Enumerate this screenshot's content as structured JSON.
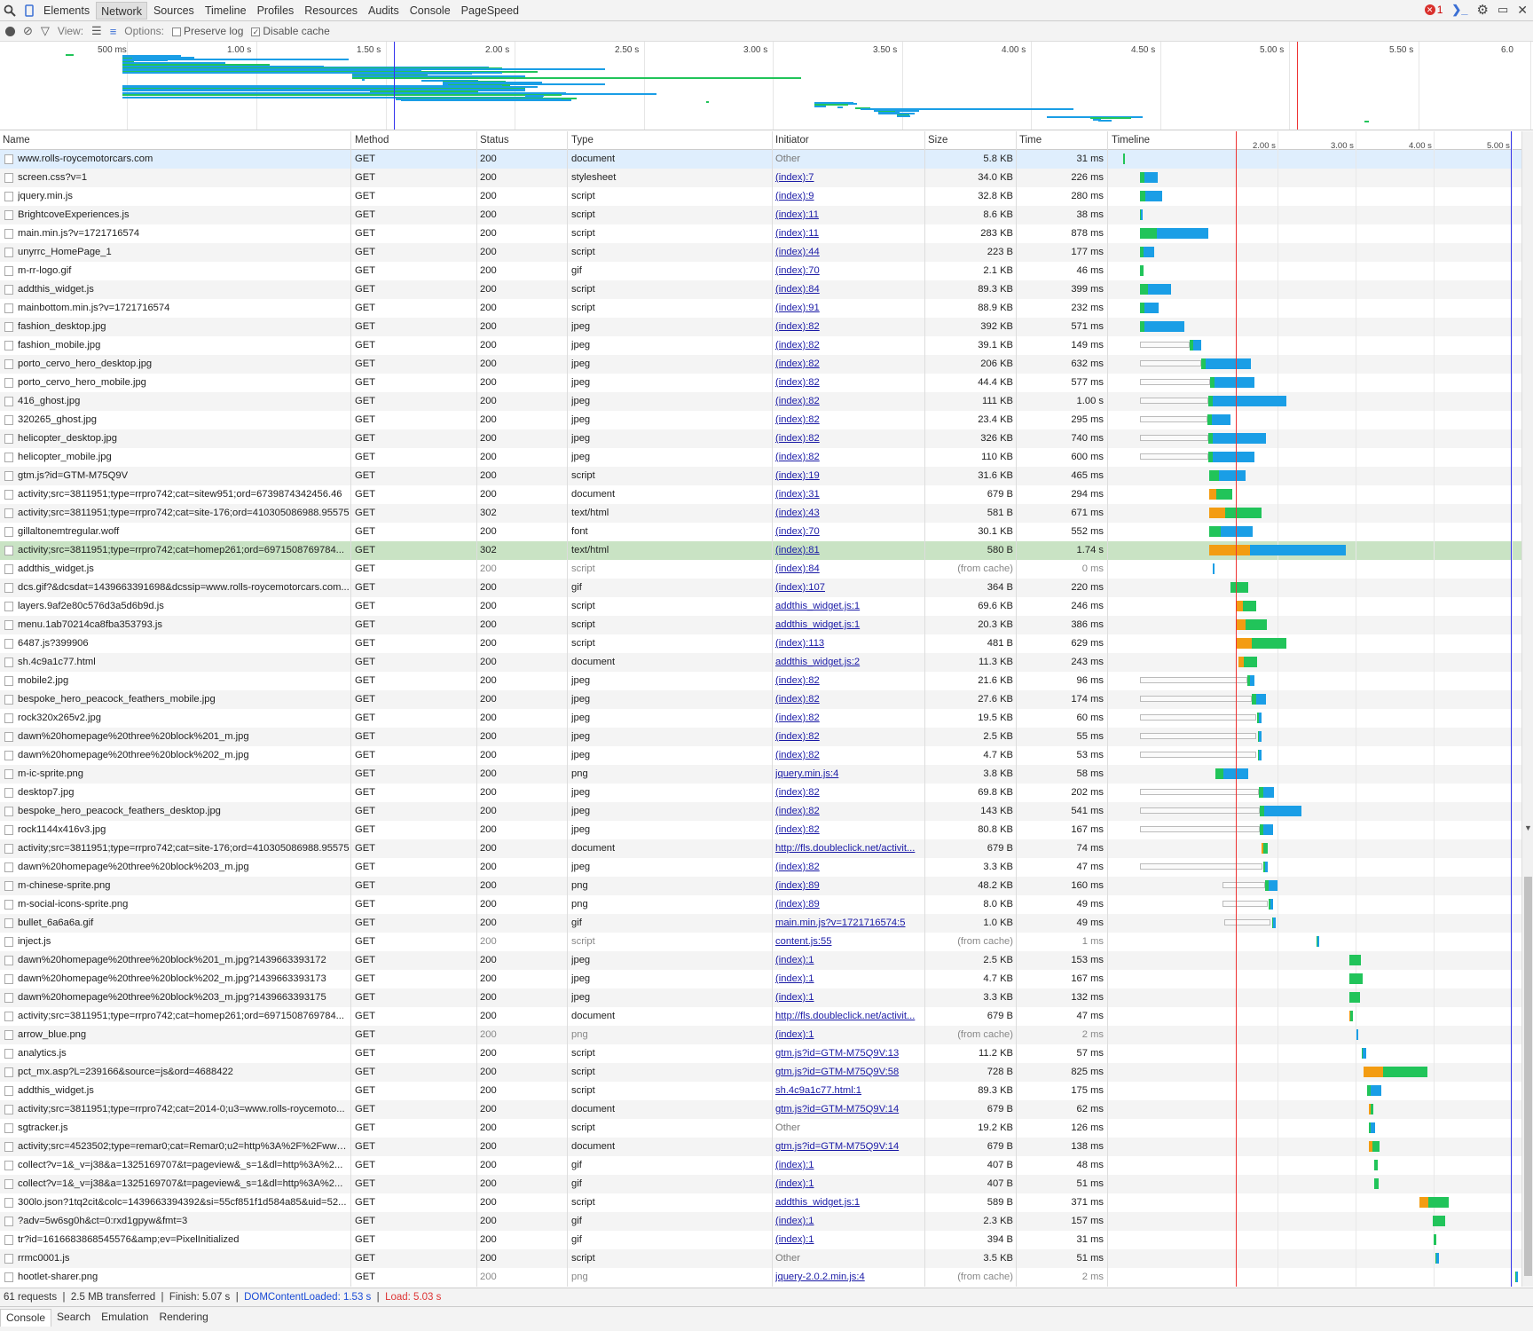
{
  "tabs": [
    "Elements",
    "Network",
    "Sources",
    "Timeline",
    "Profiles",
    "Resources",
    "Audits",
    "Console",
    "PageSpeed"
  ],
  "active_tab": "Network",
  "error_count": "1",
  "toolbar": {
    "view_label": "View:",
    "options_label": "Options:",
    "preserve_log": "Preserve log",
    "disable_cache": "Disable cache",
    "preserve_log_checked": false,
    "disable_cache_checked": true
  },
  "overview_labels": [
    "500 ms",
    "1.00 s",
    "1.50 s",
    "2.00 s",
    "2.50 s",
    "3.00 s",
    "3.50 s",
    "4.00 s",
    "4.50 s",
    "5.00 s",
    "5.50 s",
    "6.0"
  ],
  "columns": {
    "name": "Name",
    "method": "Method",
    "status": "Status",
    "type": "Type",
    "initiator": "Initiator",
    "size": "Size",
    "time": "Time",
    "timeline": "Timeline"
  },
  "timeline_labels": [
    "2.00 s",
    "3.00 s",
    "4.00 s",
    "5.00 s"
  ],
  "colors": {
    "blue": "#1a9ee6",
    "green": "#21c45a",
    "orange": "#f39c12",
    "gray": "#a0a0a0",
    "dom_line": "#3333ee",
    "load_line": "#e33333"
  },
  "requests": [
    {
      "name": "www.rolls-roycemotorcars.com",
      "method": "GET",
      "status": "200",
      "type": "document",
      "initiator": "Other",
      "size": "5.8 KB",
      "time": "31 ms",
      "start": 0.02,
      "dur": 0.031
    },
    {
      "name": "screen.css?v=1",
      "method": "GET",
      "status": "200",
      "type": "stylesheet",
      "initiator": "(index):7",
      "size": "34.0 KB",
      "time": "226 ms",
      "start": 0.24,
      "dur": 0.226
    },
    {
      "name": "jquery.min.js",
      "method": "GET",
      "status": "200",
      "type": "script",
      "initiator": "(index):9",
      "size": "32.8 KB",
      "time": "280 ms",
      "start": 0.24,
      "dur": 0.28
    },
    {
      "name": "BrightcoveExperiences.js",
      "method": "GET",
      "status": "200",
      "type": "script",
      "initiator": "(index):11",
      "size": "8.6 KB",
      "time": "38 ms",
      "start": 0.24,
      "dur": 0.038
    },
    {
      "name": "main.min.js?v=1721716574",
      "method": "GET",
      "status": "200",
      "type": "script",
      "initiator": "(index):11",
      "size": "283 KB",
      "time": "878 ms",
      "start": 0.24,
      "dur": 0.878
    },
    {
      "name": "unyrrc_HomePage_1",
      "method": "GET",
      "status": "200",
      "type": "script",
      "initiator": "(index):44",
      "size": "223 B",
      "time": "177 ms",
      "start": 0.24,
      "dur": 0.177
    },
    {
      "name": "m-rr-logo.gif",
      "method": "GET",
      "status": "200",
      "type": "gif",
      "initiator": "(index):70",
      "size": "2.1 KB",
      "time": "46 ms",
      "start": 0.24,
      "dur": 0.046
    },
    {
      "name": "addthis_widget.js",
      "method": "GET",
      "status": "200",
      "type": "script",
      "initiator": "(index):84",
      "size": "89.3 KB",
      "time": "399 ms",
      "start": 0.24,
      "dur": 0.399
    },
    {
      "name": "mainbottom.min.js?v=1721716574",
      "method": "GET",
      "status": "200",
      "type": "script",
      "initiator": "(index):91",
      "size": "88.9 KB",
      "time": "232 ms",
      "start": 0.24,
      "dur": 0.232
    },
    {
      "name": "fashion_desktop.jpg",
      "method": "GET",
      "status": "200",
      "type": "jpeg",
      "initiator": "(index):82",
      "size": "392 KB",
      "time": "571 ms",
      "start": 0.24,
      "dur": 0.571
    },
    {
      "name": "fashion_mobile.jpg",
      "method": "GET",
      "status": "200",
      "type": "jpeg",
      "initiator": "(index):82",
      "size": "39.1 KB",
      "time": "149 ms",
      "start": 0.24,
      "dur": 0.78
    },
    {
      "name": "porto_cervo_hero_desktop.jpg",
      "method": "GET",
      "status": "200",
      "type": "jpeg",
      "initiator": "(index):82",
      "size": "206 KB",
      "time": "632 ms",
      "start": 0.24,
      "dur": 1.42
    },
    {
      "name": "porto_cervo_hero_mobile.jpg",
      "method": "GET",
      "status": "200",
      "type": "jpeg",
      "initiator": "(index):82",
      "size": "44.4 KB",
      "time": "577 ms",
      "start": 0.24,
      "dur": 1.47
    },
    {
      "name": "416_ghost.jpg",
      "method": "GET",
      "status": "200",
      "type": "jpeg",
      "initiator": "(index):82",
      "size": "111 KB",
      "time": "1.00 s",
      "start": 0.24,
      "dur": 1.87
    },
    {
      "name": "320265_ghost.jpg",
      "method": "GET",
      "status": "200",
      "type": "jpeg",
      "initiator": "(index):82",
      "size": "23.4 KB",
      "time": "295 ms",
      "start": 0.24,
      "dur": 1.16
    },
    {
      "name": "helicopter_desktop.jpg",
      "method": "GET",
      "status": "200",
      "type": "jpeg",
      "initiator": "(index):82",
      "size": "326 KB",
      "time": "740 ms",
      "start": 0.24,
      "dur": 1.61
    },
    {
      "name": "helicopter_mobile.jpg",
      "method": "GET",
      "status": "200",
      "type": "jpeg",
      "initiator": "(index):82",
      "size": "110 KB",
      "time": "600 ms",
      "start": 0.24,
      "dur": 1.47
    },
    {
      "name": "gtm.js?id=GTM-M75Q9V",
      "method": "GET",
      "status": "200",
      "type": "script",
      "initiator": "(index):19",
      "size": "31.6 KB",
      "time": "465 ms",
      "start": 1.13,
      "dur": 0.465
    },
    {
      "name": "activity;src=3811951;type=rrpro742;cat=sitew951;ord=6739874342456.46",
      "method": "GET",
      "status": "200",
      "type": "document",
      "initiator": "(index):31",
      "size": "679 B",
      "time": "294 ms",
      "start": 1.13,
      "dur": 0.294
    },
    {
      "name": "activity;src=3811951;type=rrpro742;cat=site-176;ord=410305086988.95575",
      "method": "GET",
      "status": "302",
      "type": "text/html",
      "initiator": "(index):43",
      "size": "581 B",
      "time": "671 ms",
      "start": 1.13,
      "dur": 0.671
    },
    {
      "name": "gillaltonemtregular.woff",
      "method": "GET",
      "status": "200",
      "type": "font",
      "initiator": "(index):70",
      "size": "30.1 KB",
      "time": "552 ms",
      "start": 1.13,
      "dur": 0.552
    },
    {
      "name": "activity;src=3811951;type=rrpro742;cat=homep261;ord=6971508769784...",
      "method": "GET",
      "status": "302",
      "type": "text/html",
      "initiator": "(index):81",
      "size": "580 B",
      "time": "1.74 s",
      "start": 1.13,
      "dur": 1.74
    },
    {
      "name": "addthis_widget.js",
      "method": "GET",
      "status": "200",
      "type": "script",
      "initiator": "(index):84",
      "size": "(from cache)",
      "time": "0 ms",
      "start": 1.17,
      "dur": 0.01
    },
    {
      "name": "dcs.gif?&dcsdat=1439663391698&dcssip=www.rolls-roycemotorcars.com...",
      "method": "GET",
      "status": "200",
      "type": "gif",
      "initiator": "(index):107",
      "size": "364 B",
      "time": "220 ms",
      "start": 1.4,
      "dur": 0.22
    },
    {
      "name": "layers.9af2e80c576d3a5d6b9d.js",
      "method": "GET",
      "status": "200",
      "type": "script",
      "initiator": "addthis_widget.js:1",
      "size": "69.6 KB",
      "time": "246 ms",
      "start": 1.48,
      "dur": 0.246
    },
    {
      "name": "menu.1ab70214ca8fba353793.js",
      "method": "GET",
      "status": "200",
      "type": "script",
      "initiator": "addthis_widget.js:1",
      "size": "20.3 KB",
      "time": "386 ms",
      "start": 1.48,
      "dur": 0.386
    },
    {
      "name": "6487.js?399906",
      "method": "GET",
      "status": "200",
      "type": "script",
      "initiator": "(index):113",
      "size": "481 B",
      "time": "629 ms",
      "start": 1.48,
      "dur": 0.629
    },
    {
      "name": "sh.4c9a1c77.html",
      "method": "GET",
      "status": "200",
      "type": "document",
      "initiator": "addthis_widget.js:2",
      "size": "11.3 KB",
      "time": "243 ms",
      "start": 1.5,
      "dur": 0.243
    },
    {
      "name": "mobile2.jpg",
      "method": "GET",
      "status": "200",
      "type": "jpeg",
      "initiator": "(index):82",
      "size": "21.6 KB",
      "time": "96 ms",
      "start": 0.24,
      "dur": 1.47
    },
    {
      "name": "bespoke_hero_peacock_feathers_mobile.jpg",
      "method": "GET",
      "status": "200",
      "type": "jpeg",
      "initiator": "(index):82",
      "size": "27.6 KB",
      "time": "174 ms",
      "start": 0.24,
      "dur": 1.61
    },
    {
      "name": "rock320x265v2.jpg",
      "method": "GET",
      "status": "200",
      "type": "jpeg",
      "initiator": "(index):82",
      "size": "19.5 KB",
      "time": "60 ms",
      "start": 0.24,
      "dur": 1.56
    },
    {
      "name": "dawn%20homepage%20three%20block%201_m.jpg",
      "method": "GET",
      "status": "200",
      "type": "jpeg",
      "initiator": "(index):82",
      "size": "2.5 KB",
      "time": "55 ms",
      "start": 0.24,
      "dur": 1.56
    },
    {
      "name": "dawn%20homepage%20three%20block%202_m.jpg",
      "method": "GET",
      "status": "200",
      "type": "jpeg",
      "initiator": "(index):82",
      "size": "4.7 KB",
      "time": "53 ms",
      "start": 0.24,
      "dur": 1.56
    },
    {
      "name": "m-ic-sprite.png",
      "method": "GET",
      "status": "200",
      "type": "png",
      "initiator": "jquery.min.js:4",
      "size": "3.8 KB",
      "time": "58 ms",
      "start": 1.2,
      "dur": 0.42
    },
    {
      "name": "desktop7.jpg",
      "method": "GET",
      "status": "200",
      "type": "jpeg",
      "initiator": "(index):82",
      "size": "69.8 KB",
      "time": "202 ms",
      "start": 0.24,
      "dur": 1.72
    },
    {
      "name": "bespoke_hero_peacock_feathers_desktop.jpg",
      "method": "GET",
      "status": "200",
      "type": "jpeg",
      "initiator": "(index):82",
      "size": "143 KB",
      "time": "541 ms",
      "start": 0.24,
      "dur": 2.07
    },
    {
      "name": "rock1144x416v3.jpg",
      "method": "GET",
      "status": "200",
      "type": "jpeg",
      "initiator": "(index):82",
      "size": "80.8 KB",
      "time": "167 ms",
      "start": 0.24,
      "dur": 1.7
    },
    {
      "name": "activity;src=3811951;type=rrpro742;cat=site-176;ord=410305086988.95575",
      "method": "GET",
      "status": "200",
      "type": "document",
      "initiator": "http://fls.doubleclick.net/activit...",
      "size": "679 B",
      "time": "74 ms",
      "start": 1.8,
      "dur": 0.074
    },
    {
      "name": "dawn%20homepage%20three%20block%203_m.jpg",
      "method": "GET",
      "status": "200",
      "type": "jpeg",
      "initiator": "(index):82",
      "size": "3.3 KB",
      "time": "47 ms",
      "start": 0.24,
      "dur": 1.63
    },
    {
      "name": "m-chinese-sprite.png",
      "method": "GET",
      "status": "200",
      "type": "png",
      "initiator": "(index):89",
      "size": "48.2 KB",
      "time": "160 ms",
      "start": 1.3,
      "dur": 0.7
    },
    {
      "name": "m-social-icons-sprite.png",
      "method": "GET",
      "status": "200",
      "type": "png",
      "initiator": "(index):89",
      "size": "8.0 KB",
      "time": "49 ms",
      "start": 1.3,
      "dur": 0.64
    },
    {
      "name": "bullet_6a6a6a.gif",
      "method": "GET",
      "status": "200",
      "type": "gif",
      "initiator": "main.min.js?v=1721716574:5",
      "size": "1.0 KB",
      "time": "49 ms",
      "start": 1.32,
      "dur": 0.66
    },
    {
      "name": "inject.js",
      "method": "GET",
      "status": "200",
      "type": "script",
      "initiator": "content.js:55",
      "size": "(from cache)",
      "time": "1 ms",
      "start": 2.5,
      "dur": 0.01
    },
    {
      "name": "dawn%20homepage%20three%20block%201_m.jpg?1439663393172",
      "method": "GET",
      "status": "200",
      "type": "jpeg",
      "initiator": "(index):1",
      "size": "2.5 KB",
      "time": "153 ms",
      "start": 2.92,
      "dur": 0.153
    },
    {
      "name": "dawn%20homepage%20three%20block%202_m.jpg?1439663393173",
      "method": "GET",
      "status": "200",
      "type": "jpeg",
      "initiator": "(index):1",
      "size": "4.7 KB",
      "time": "167 ms",
      "start": 2.92,
      "dur": 0.167
    },
    {
      "name": "dawn%20homepage%20three%20block%203_m.jpg?1439663393175",
      "method": "GET",
      "status": "200",
      "type": "jpeg",
      "initiator": "(index):1",
      "size": "3.3 KB",
      "time": "132 ms",
      "start": 2.92,
      "dur": 0.132
    },
    {
      "name": "activity;src=3811951;type=rrpro742;cat=homep261;ord=6971508769784...",
      "method": "GET",
      "status": "200",
      "type": "document",
      "initiator": "http://fls.doubleclick.net/activit...",
      "size": "679 B",
      "time": "47 ms",
      "start": 2.92,
      "dur": 0.047
    },
    {
      "name": "arrow_blue.png",
      "method": "GET",
      "status": "200",
      "type": "png",
      "initiator": "(index):1",
      "size": "(from cache)",
      "time": "2 ms",
      "start": 3.01,
      "dur": 0.02
    },
    {
      "name": "analytics.js",
      "method": "GET",
      "status": "200",
      "type": "script",
      "initiator": "gtm.js?id=GTM-M75Q9V:13",
      "size": "11.2 KB",
      "time": "57 ms",
      "start": 3.08,
      "dur": 0.057
    },
    {
      "name": "pct_mx.asp?L=239166&source=js&ord=4688422",
      "method": "GET",
      "status": "200",
      "type": "script",
      "initiator": "gtm.js?id=GTM-M75Q9V:58",
      "size": "728 B",
      "time": "825 ms",
      "start": 3.1,
      "dur": 0.825
    },
    {
      "name": "addthis_widget.js",
      "method": "GET",
      "status": "200",
      "type": "script",
      "initiator": "sh.4c9a1c77.html:1",
      "size": "89.3 KB",
      "time": "175 ms",
      "start": 3.15,
      "dur": 0.175
    },
    {
      "name": "activity;src=3811951;type=rrpro742;cat=2014-0;u3=www.rolls-roycemoto...",
      "method": "GET",
      "status": "200",
      "type": "document",
      "initiator": "gtm.js?id=GTM-M75Q9V:14",
      "size": "679 B",
      "time": "62 ms",
      "start": 3.17,
      "dur": 0.062
    },
    {
      "name": "sgtracker.js",
      "method": "GET",
      "status": "200",
      "type": "script",
      "initiator": "Other",
      "size": "19.2 KB",
      "time": "126 ms",
      "start": 3.17,
      "dur": 0.08
    },
    {
      "name": "activity;src=4523502;type=remar0;cat=Remar0;u2=http%3A%2F%2Fwww....",
      "method": "GET",
      "status": "200",
      "type": "document",
      "initiator": "gtm.js?id=GTM-M75Q9V:14",
      "size": "679 B",
      "time": "138 ms",
      "start": 3.17,
      "dur": 0.138
    },
    {
      "name": "collect?v=1&_v=j38&a=1325169707&t=pageview&_s=1&dl=http%3A%2...",
      "method": "GET",
      "status": "200",
      "type": "gif",
      "initiator": "(index):1",
      "size": "407 B",
      "time": "48 ms",
      "start": 3.24,
      "dur": 0.048
    },
    {
      "name": "collect?v=1&_v=j38&a=1325169707&t=pageview&_s=1&dl=http%3A%2...",
      "method": "GET",
      "status": "200",
      "type": "gif",
      "initiator": "(index):1",
      "size": "407 B",
      "time": "51 ms",
      "start": 3.24,
      "dur": 0.051
    },
    {
      "name": "300lo.json?1tq2cit&colc=1439663394392&si=55cf851f1d584a85&uid=52...",
      "method": "GET",
      "status": "200",
      "type": "script",
      "initiator": "addthis_widget.js:1",
      "size": "589 B",
      "time": "371 ms",
      "start": 3.82,
      "dur": 0.371
    },
    {
      "name": "?adv=5w6sg0h&ct=0:rxd1gpyw&fmt=3",
      "method": "GET",
      "status": "200",
      "type": "gif",
      "initiator": "(index):1",
      "size": "2.3 KB",
      "time": "157 ms",
      "start": 3.99,
      "dur": 0.157
    },
    {
      "name": "tr?id=1616683868545576&amp;ev=PixelInitialized",
      "method": "GET",
      "status": "200",
      "type": "gif",
      "initiator": "(index):1",
      "size": "394 B",
      "time": "31 ms",
      "start": 4.0,
      "dur": 0.031
    },
    {
      "name": "rrmc0001.js",
      "method": "GET",
      "status": "200",
      "type": "script",
      "initiator": "Other",
      "size": "3.5 KB",
      "time": "51 ms",
      "start": 4.02,
      "dur": 0.051
    },
    {
      "name": "hootlet-sharer.png",
      "method": "GET",
      "status": "200",
      "type": "png",
      "initiator": "jquery-2.0.2.min.js:4",
      "size": "(from cache)",
      "time": "2 ms",
      "start": 5.05,
      "dur": 0.02
    }
  ],
  "status": {
    "requests": "61 requests",
    "transferred": "2.5 MB transferred",
    "finish": "Finish: 5.07 s",
    "dcl": "DOMContentLoaded: 1.53 s",
    "load": "Load: 5.03 s"
  },
  "drawer_tabs": [
    "Console",
    "Search",
    "Emulation",
    "Rendering"
  ]
}
